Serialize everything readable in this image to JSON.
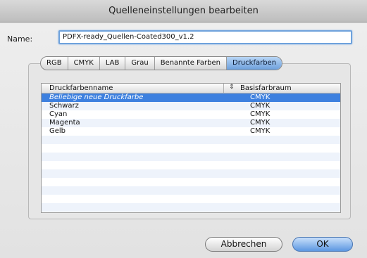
{
  "window": {
    "title": "Quelleneinstellungen bearbeiten"
  },
  "name_field": {
    "label": "Name:",
    "value": "PDFX-ready_Quellen-Coated300_v1.2"
  },
  "tabs": [
    {
      "label": "RGB",
      "active": false
    },
    {
      "label": "CMYK",
      "active": false
    },
    {
      "label": "LAB",
      "active": false
    },
    {
      "label": "Grau",
      "active": false
    },
    {
      "label": "Benannte Farben",
      "active": false
    },
    {
      "label": "Druckfarben",
      "active": true
    }
  ],
  "table": {
    "columns": [
      "Druckfarbenname",
      "Basisfarbraum"
    ],
    "rows": [
      {
        "name": "Beliebige neue Druckfarbe",
        "space": "CMYK",
        "selected": true
      },
      {
        "name": "Schwarz",
        "space": "CMYK",
        "selected": false
      },
      {
        "name": "Cyan",
        "space": "CMYK",
        "selected": false
      },
      {
        "name": "Magenta",
        "space": "CMYK",
        "selected": false
      },
      {
        "name": "Gelb",
        "space": "CMYK",
        "selected": false
      }
    ]
  },
  "buttons": {
    "cancel": "Abbrechen",
    "ok": "OK"
  },
  "colors": {
    "accent": "#3d80df",
    "selected_text": "#ffffff"
  }
}
